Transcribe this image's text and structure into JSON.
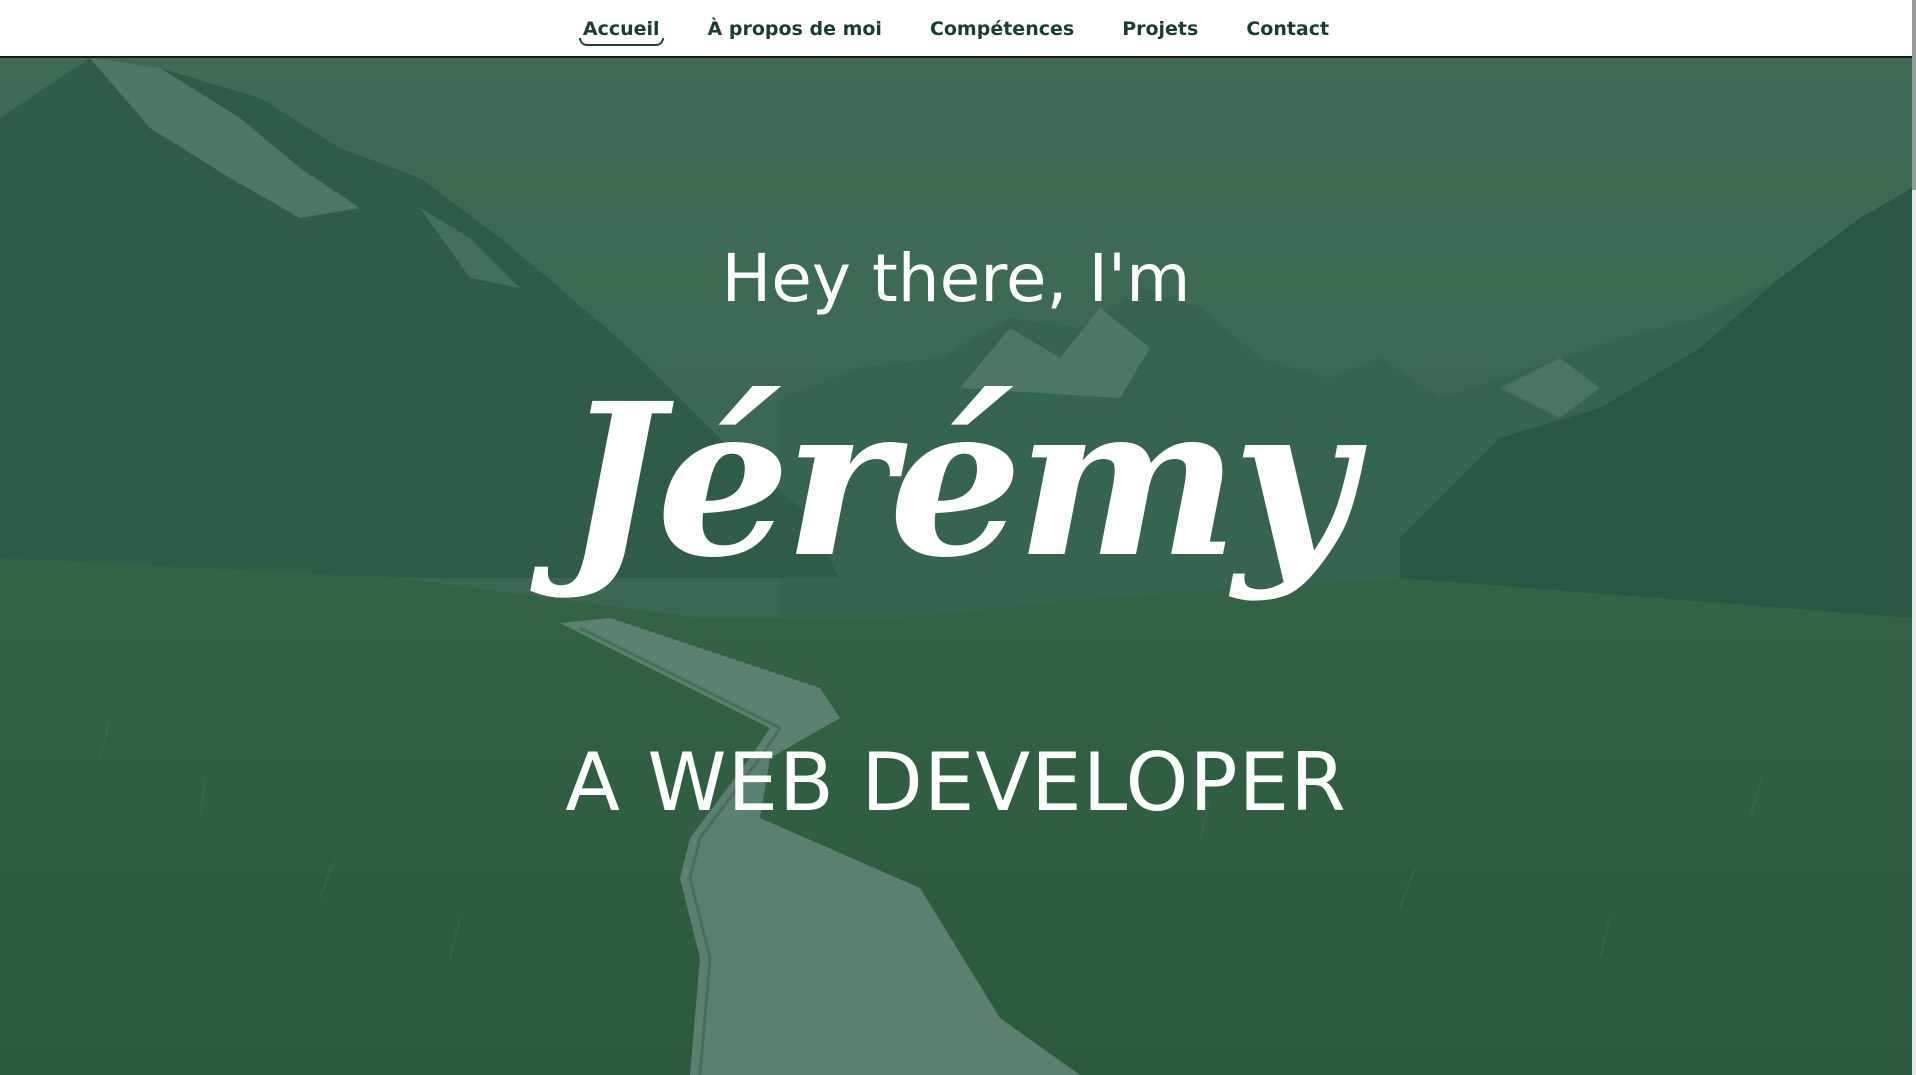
{
  "nav": {
    "items": [
      {
        "label": "Accueil",
        "active": true
      },
      {
        "label": "À propos de moi",
        "active": false
      },
      {
        "label": "Compétences",
        "active": false
      },
      {
        "label": "Projets",
        "active": false
      },
      {
        "label": "Contact",
        "active": false
      }
    ]
  },
  "hero": {
    "greeting": "Hey there, I'm",
    "name": "Jérémy",
    "role": "A WEB DEVELOPER"
  },
  "colors": {
    "nav_text": "#1b3f2e",
    "overlay": "#22583e",
    "hero_text": "#ffffff"
  }
}
